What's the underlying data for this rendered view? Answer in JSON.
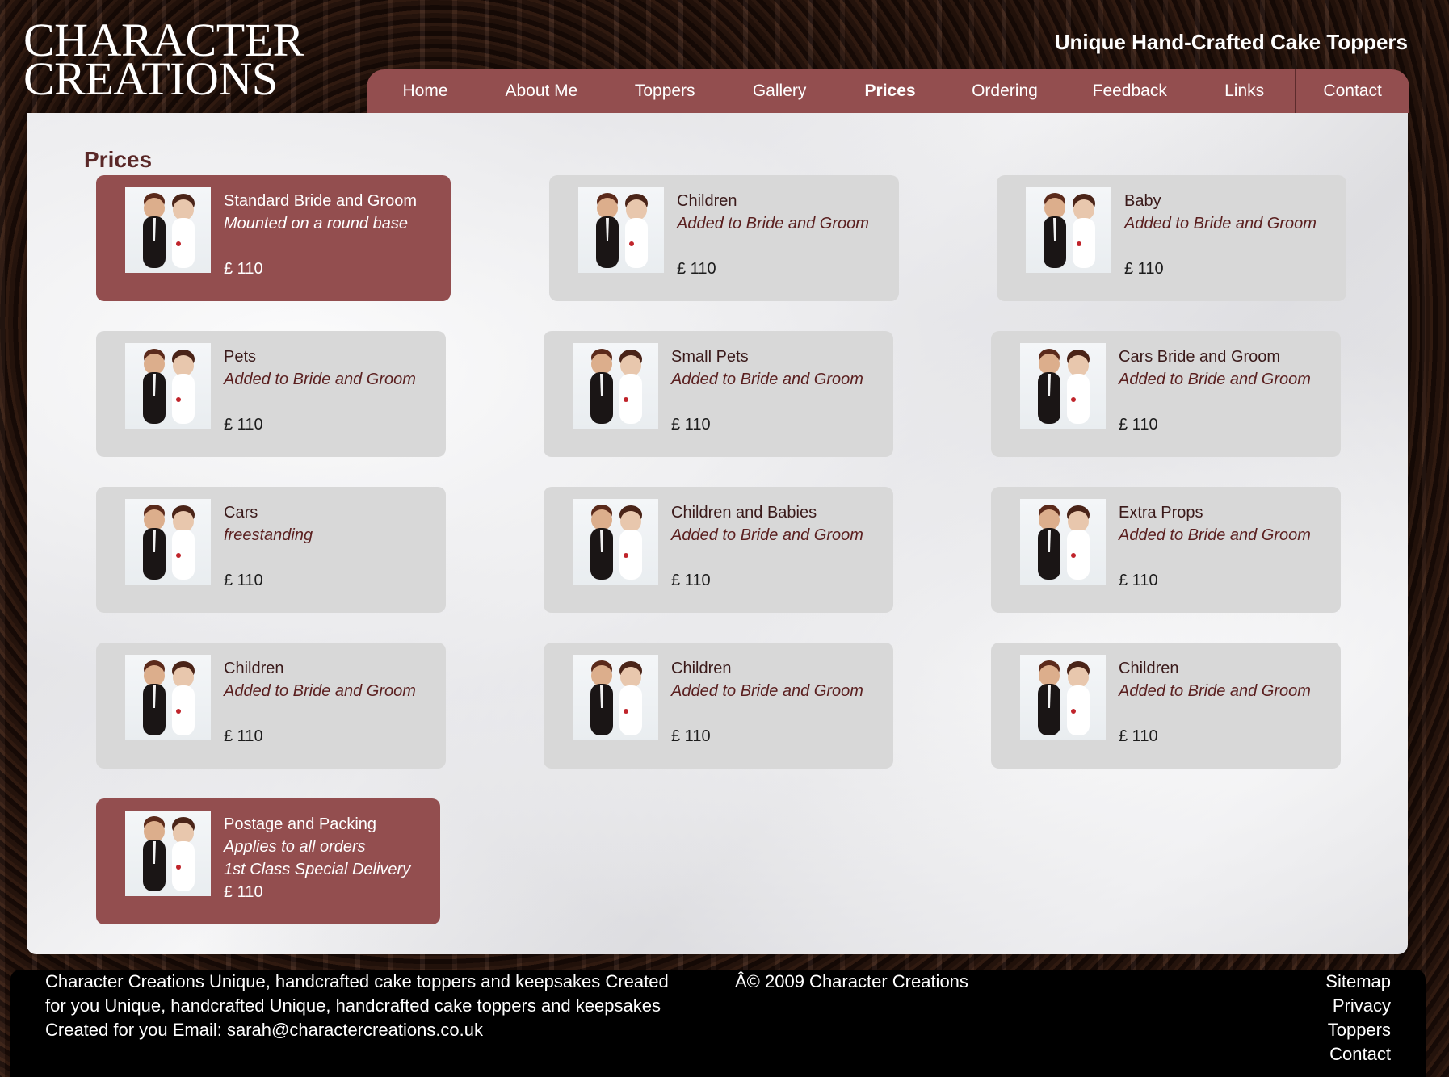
{
  "brand": {
    "line1": "CHARACTER",
    "line2": "CREATIONS"
  },
  "tagline": "Unique Hand-Crafted Cake Toppers",
  "nav": {
    "home": "Home",
    "about": "About Me",
    "toppers": "Toppers",
    "gallery": "Gallery",
    "prices": "Prices",
    "ordering": "Ordering",
    "feedback": "Feedback",
    "links": "Links",
    "contact": "Contact",
    "active": "Prices"
  },
  "page_title": "Prices",
  "cards": [
    {
      "name": "Standard Bride and Groom",
      "sub": "Mounted on a round base",
      "price": "£ 110",
      "featured": true
    },
    {
      "name": "Children",
      "sub": "Added to Bride and Groom",
      "price": "£ 110"
    },
    {
      "name": "Baby",
      "sub": "Added to Bride and Groom",
      "price": "£ 110"
    },
    {
      "name": "Pets",
      "sub": "Added to Bride and Groom",
      "price": "£ 110"
    },
    {
      "name": "Small Pets",
      "sub": "Added to Bride and Groom",
      "price": "£ 110"
    },
    {
      "name": "Cars Bride and Groom",
      "sub": "Added to Bride and Groom",
      "price": "£ 110"
    },
    {
      "name": "Cars",
      "sub": "freestanding",
      "price": "£ 110"
    },
    {
      "name": "Children and Babies",
      "sub": "Added to Bride and Groom",
      "price": "£ 110"
    },
    {
      "name": "Extra Props",
      "sub": "Added to Bride and Groom",
      "price": "£ 110"
    },
    {
      "name": "Children",
      "sub": "Added to Bride and Groom",
      "price": "£ 110"
    },
    {
      "name": "Children",
      "sub": "Added to Bride and Groom",
      "price": "£ 110"
    },
    {
      "name": "Children",
      "sub": "Added to Bride and Groom",
      "price": "£ 110"
    },
    {
      "name": "Postage and Packing",
      "sub": "Applies to all orders",
      "sub2": "1st Class Special Delivery",
      "price": "£ 110",
      "featured": true
    }
  ],
  "footer": {
    "about_line1": "Character Creations Unique, handcrafted cake toppers and keepsakes Created",
    "about_line2": "for you Unique, handcrafted Unique, handcrafted cake toppers and keepsakes",
    "about_line3": "Created for you Email: sarah@charactercreations.co.uk",
    "copyright": "Â© 2009 Character Creations",
    "links": [
      "Sitemap",
      "Privacy",
      "Toppers",
      "Contact"
    ]
  },
  "colors": {
    "accent": "#934e4f",
    "card": "#d8d8d8",
    "title": "#5a2828"
  }
}
